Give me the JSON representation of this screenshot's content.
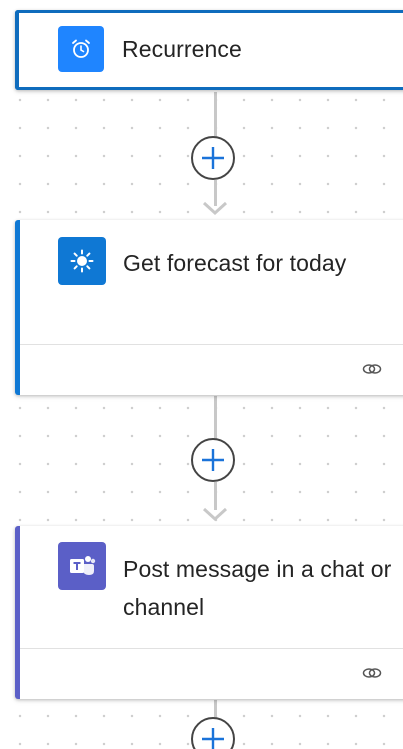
{
  "steps": [
    {
      "title": "Recurrence",
      "icon": "alarm-clock-icon",
      "accent": "#0f6cbd"
    },
    {
      "title": "Get forecast for today",
      "icon": "sun-icon",
      "accent": "#0f78d4"
    },
    {
      "title": "Post message in a chat or channel",
      "icon": "teams-icon",
      "accent": "#5b5fc7"
    }
  ]
}
